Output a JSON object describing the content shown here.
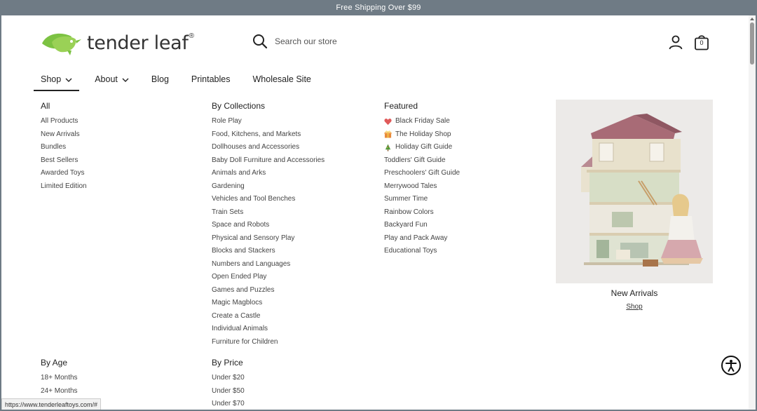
{
  "announcement": "Free Shipping Over $99",
  "brand": {
    "name": "tender leaf",
    "reg": "®"
  },
  "search": {
    "placeholder": "Search our store"
  },
  "cart": {
    "count": "0"
  },
  "nav": {
    "shop": "Shop",
    "about": "About",
    "blog": "Blog",
    "printables": "Printables",
    "wholesale": "Wholesale Site"
  },
  "mega": {
    "all": {
      "heading": "All",
      "items": [
        "All Products",
        "New Arrivals",
        "Bundles",
        "Best Sellers",
        "Awarded Toys",
        "Limited Edition"
      ]
    },
    "collections": {
      "heading": "By Collections",
      "items": [
        "Role Play",
        "Food, Kitchens, and Markets",
        "Dollhouses and Accessories",
        "Baby Doll Furniture and Accessories",
        "Animals and Arks",
        "Gardening",
        "Vehicles and Tool Benches",
        "Train Sets",
        "Space and Robots",
        "Physical and Sensory Play",
        "Blocks and Stackers",
        "Numbers and Languages",
        "Open Ended Play",
        "Games and Puzzles",
        "Magic Magblocs",
        "Create a Castle",
        "Individual Animals",
        "Furniture for Children"
      ]
    },
    "featured": {
      "heading": "Featured",
      "items": [
        "Black Friday Sale",
        "The Holiday Shop",
        "Holiday Gift Guide",
        "Toddlers' Gift Guide",
        "Preschoolers' Gift Guide",
        "Merrywood Tales",
        "Summer Time",
        "Rainbow Colors",
        "Backyard Fun",
        "Play and Pack Away",
        "Educational Toys"
      ]
    },
    "age": {
      "heading": "By Age",
      "items": [
        "18+ Months",
        "24+ Months"
      ]
    },
    "price": {
      "heading": "By Price",
      "items": [
        "Under $20",
        "Under $50",
        "Under $70"
      ]
    },
    "promo": {
      "title": "New Arrivals",
      "link": "Shop"
    }
  },
  "status_url": "https://www.tenderleaftoys.com/#",
  "colors": {
    "brand_green": "#7cc242",
    "bar_gray": "#6f7b85"
  }
}
